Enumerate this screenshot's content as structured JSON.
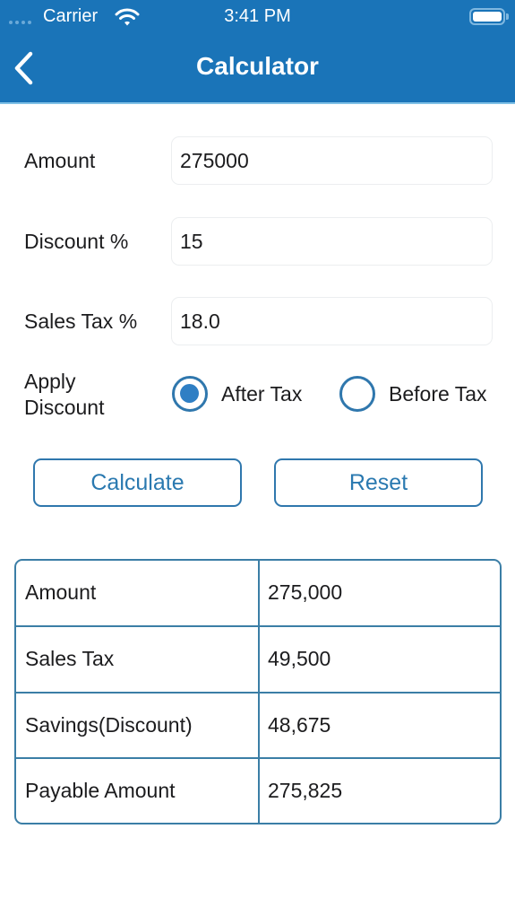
{
  "status_bar": {
    "carrier": "Carrier",
    "time": "3:41 PM",
    "wifi_icon": "wifi-icon",
    "battery_icon": "battery-full-icon"
  },
  "nav": {
    "title": "Calculator",
    "back_icon": "chevron-left-icon"
  },
  "form": {
    "amount": {
      "label": "Amount",
      "value": "275000"
    },
    "discount": {
      "label": "Discount %",
      "value": "15"
    },
    "sales_tax": {
      "label": "Sales Tax %",
      "value": "18.0"
    },
    "apply_discount": {
      "label_line1": "Apply",
      "label_line2": "Discount",
      "options": [
        {
          "label": "After Tax",
          "selected": true
        },
        {
          "label": "Before Tax",
          "selected": false
        }
      ]
    }
  },
  "buttons": {
    "calculate": "Calculate",
    "reset": "Reset"
  },
  "results": {
    "rows": [
      {
        "label": "Amount",
        "value": "275,000"
      },
      {
        "label": "Sales Tax",
        "value": "49,500"
      },
      {
        "label": "Savings(Discount)",
        "value": "48,675"
      },
      {
        "label": "Payable Amount",
        "value": "275,825"
      }
    ]
  },
  "colors": {
    "header_bg": "#1a74b8",
    "accent": "#2f77ad",
    "table_border": "#3b7ea6",
    "text": "#1c1c1e"
  }
}
